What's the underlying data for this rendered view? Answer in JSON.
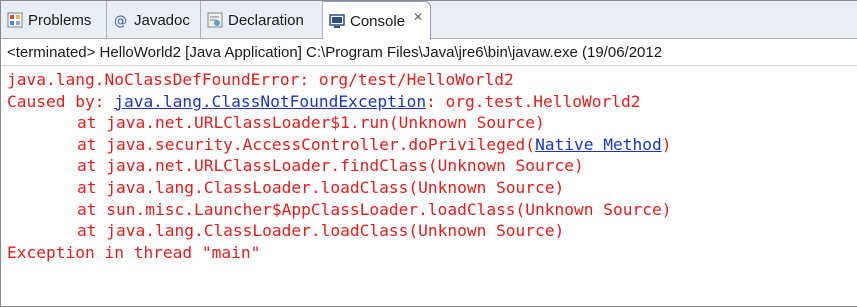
{
  "tabs": [
    {
      "label": "Problems",
      "icon": "problems-icon",
      "active": false
    },
    {
      "label": "Javadoc",
      "icon": "javadoc-icon",
      "active": false
    },
    {
      "label": "Declaration",
      "icon": "declaration-icon",
      "active": false
    },
    {
      "label": "Console",
      "icon": "console-icon",
      "active": true,
      "close_glyph": "✕"
    }
  ],
  "console": {
    "status": "<terminated> HelloWorld2 [Java Application] C:\\Program Files\\Java\\jre6\\bin\\javaw.exe (19/06/2012",
    "line1": "java.lang.NoClassDefFoundError: org/test/HelloWorld2",
    "line2_prefix": "Caused by: ",
    "line2_link": "java.lang.ClassNotFoundException",
    "line2_suffix": ": org.test.HelloWorld2",
    "frame1": "at java.net.URLClassLoader$1.run(Unknown Source)",
    "frame2_prefix": "at java.security.AccessController.doPrivileged(",
    "frame2_link": "Native Method",
    "frame2_suffix": ")",
    "frame3": "at java.net.URLClassLoader.findClass(Unknown Source)",
    "frame4": "at java.lang.ClassLoader.loadClass(Unknown Source)",
    "frame5": "at sun.misc.Launcher$AppClassLoader.loadClass(Unknown Source)",
    "frame6": "at java.lang.ClassLoader.loadClass(Unknown Source)",
    "line_last": "Exception in thread \"main\""
  },
  "colors": {
    "error_text": "#e41c1c",
    "link_text": "#1a35c8",
    "tabbar_bg": "#e9eef5"
  }
}
